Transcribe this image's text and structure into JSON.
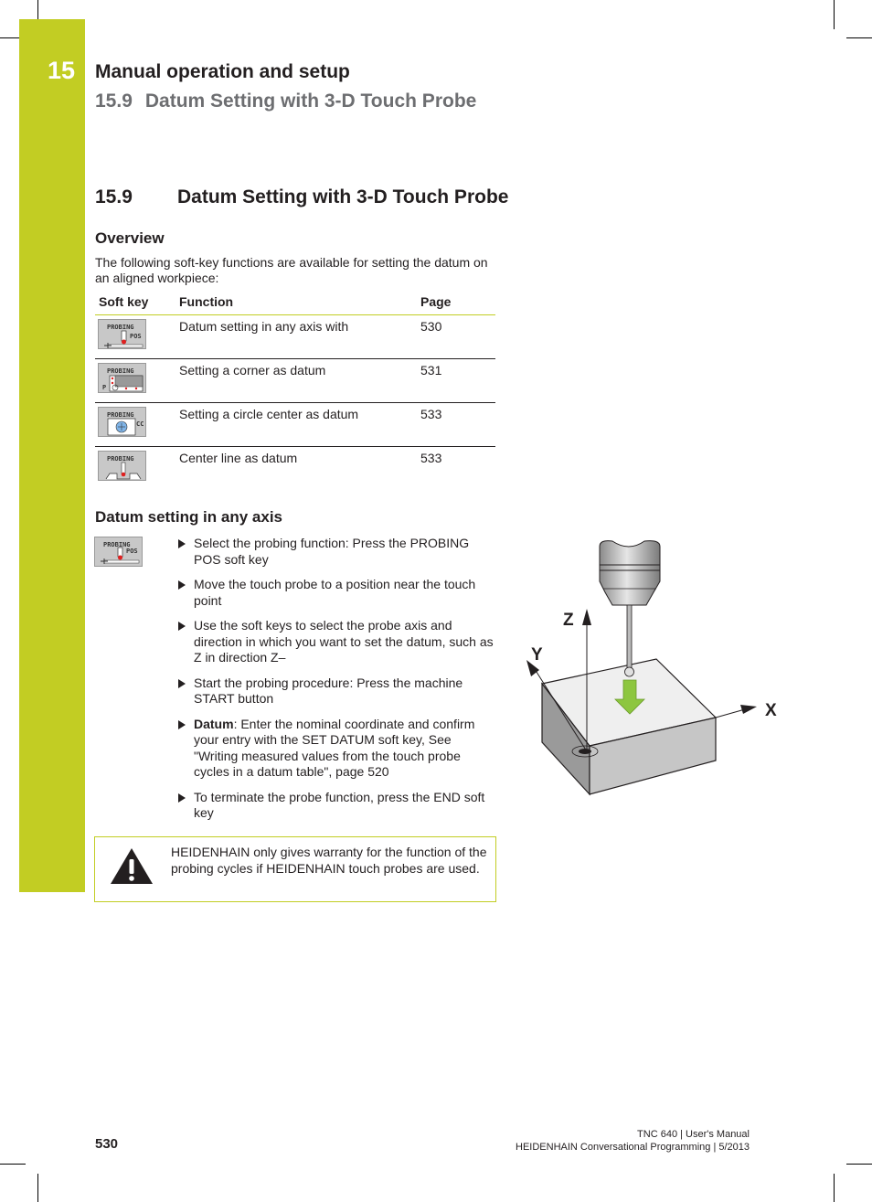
{
  "header": {
    "chapter_number": "15",
    "chapter_title": "Manual operation and setup",
    "section_number": "15.9",
    "section_title": "Datum Setting with 3-D Touch Probe"
  },
  "section": {
    "number": "15.9",
    "title": "Datum Setting with 3-D Touch Probe"
  },
  "overview": {
    "heading": "Overview",
    "intro": "The following soft-key functions are available for setting the datum on an aligned workpiece:",
    "table": {
      "headers": [
        "Soft key",
        "Function",
        "Page"
      ],
      "rows": [
        {
          "softkey_label": "PROBING",
          "softkey_sublabel": "POS",
          "softkey_icon": "probing-pos-softkey-icon",
          "function": "Datum setting in any axis with",
          "page": "530"
        },
        {
          "softkey_label": "PROBING",
          "softkey_sublabel": "P",
          "softkey_icon": "probing-corner-softkey-icon",
          "function": "Setting a corner as datum",
          "page": "531"
        },
        {
          "softkey_label": "PROBING",
          "softkey_sublabel": "CC",
          "softkey_icon": "probing-circle-center-softkey-icon",
          "function": "Setting a circle center as datum",
          "page": "533"
        },
        {
          "softkey_label": "PROBING",
          "softkey_sublabel": "",
          "softkey_icon": "probing-center-line-softkey-icon",
          "function": "Center line as datum",
          "page": "533"
        }
      ]
    }
  },
  "any_axis": {
    "heading": "Datum setting in any axis",
    "softkey_label": "PROBING",
    "softkey_sublabel": "POS",
    "steps": [
      {
        "bold": "",
        "text": "Select the probing function: Press the PROBING POS soft key"
      },
      {
        "bold": "",
        "text": "Move the touch probe to a position near the touch point"
      },
      {
        "bold": "",
        "text": "Use the soft keys to select the probe axis and direction in which you want to set the datum, such as Z in direction Z–"
      },
      {
        "bold": "",
        "text": "Start the probing procedure: Press the machine START button"
      },
      {
        "bold": "Datum",
        "text": ": Enter the nominal coordinate and confirm your entry with the SET DATUM soft key, See \"Writing measured values from the touch probe cycles in a datum table\", page 520"
      },
      {
        "bold": "",
        "text": "To terminate the probe function, press the END soft key"
      }
    ],
    "figure": {
      "axis_labels": {
        "x": "X",
        "y": "Y",
        "z": "Z"
      },
      "arrow_color": "#8dc63f"
    }
  },
  "warning": {
    "icon": "warning-icon",
    "text": "HEIDENHAIN only gives warranty for the function of the probing cycles if HEIDENHAIN touch probes are used."
  },
  "footer": {
    "page_number": "530",
    "line1": "TNC 640 | User's Manual",
    "line2": "HEIDENHAIN Conversational Programming | 5/2013"
  },
  "colors": {
    "accent": "#c2cd23",
    "text": "#231f20",
    "subheader": "#6d6e71"
  }
}
